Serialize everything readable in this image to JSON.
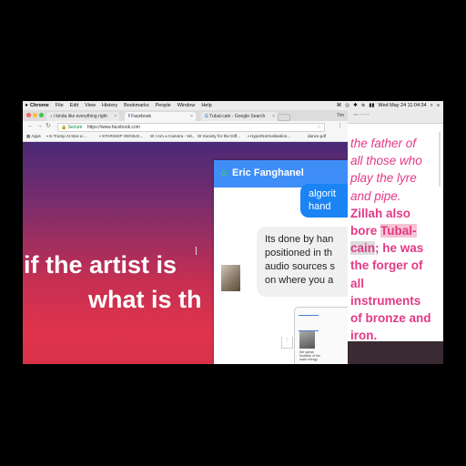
{
  "menubar": {
    "apple": "",
    "items": [
      "Chrome",
      "File",
      "Edit",
      "View",
      "History",
      "Bookmarks",
      "People",
      "Window",
      "Help"
    ],
    "status": [
      "⌘",
      "◎",
      "✱",
      "≋",
      "▮▮"
    ],
    "datetime": "Wed May 24  11:04:34"
  },
  "browser": {
    "tabs": [
      {
        "label": "i kinda like everything right"
      },
      {
        "label": "Facebook"
      },
      {
        "label": "Tubal-cain - Google Search"
      }
    ],
    "profile": "Tim",
    "secure_label": "Secure",
    "url": "https://www.facebook.com",
    "bookmarks": [
      "Apps",
      "Is Trump At Mar-a-...",
      "STARSHIP GENIUS...",
      "I Am a Camera - Wi...",
      "Society for the Diff...",
      "HyperNormalisation...",
      "dance.pdf"
    ]
  },
  "content": {
    "line1": "if the artist is",
    "line2": "what is th"
  },
  "chat": {
    "name": "Eric Fanghanel",
    "outgoing": [
      "algorit",
      "hand"
    ],
    "incoming": [
      "Its done by han",
      "positioned in th",
      "audio sources s",
      "on where you a"
    ],
    "thumb_text": "We speak\nfoolishly of the\nmale energy"
  },
  "editor": {
    "lines": [
      {
        "pre": "the father of",
        "hl": "",
        "post": "",
        "bold": false
      },
      {
        "pre": "all those who",
        "hl": "",
        "post": "",
        "bold": false
      },
      {
        "pre": "play the lyre",
        "hl": "",
        "post": "",
        "bold": false
      },
      {
        "pre": "and pipe.",
        "hl": "",
        "post": "",
        "bold": false
      },
      {
        "pre": "Zillah also",
        "hl": "",
        "post": "",
        "bold": true
      },
      {
        "pre": "bore ",
        "hl": "Tubal-",
        "post": "",
        "bold": true
      },
      {
        "pre": "",
        "hl": "cain",
        "post": "; he was",
        "bold": true
      },
      {
        "pre": "the forger of",
        "hl": "",
        "post": "",
        "bold": true
      },
      {
        "pre": "all",
        "hl": "",
        "post": "",
        "bold": true
      },
      {
        "pre": "instruments",
        "hl": "",
        "post": "",
        "bold": true
      },
      {
        "pre": "of bronze and",
        "hl": "",
        "post": "",
        "bold": true
      },
      {
        "pre": "iron.",
        "hl": "",
        "post": "",
        "bold": true
      }
    ]
  }
}
